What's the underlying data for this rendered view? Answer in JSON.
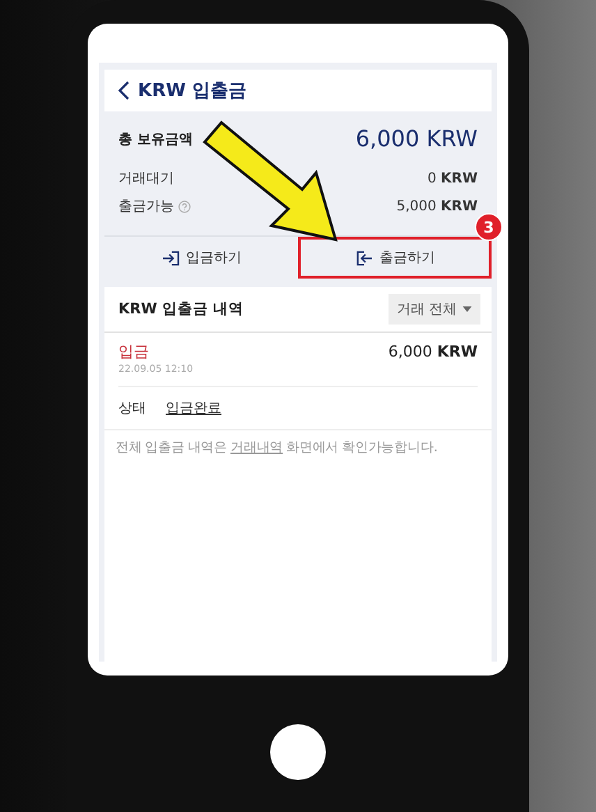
{
  "header": {
    "title": "KRW 입출금"
  },
  "summary": {
    "total_label": "총 보유금액",
    "total_value": "6,000 KRW",
    "rows": [
      {
        "label": "거래대기",
        "amount": "0 **KRW**",
        "help": false
      },
      {
        "label": "출금가능",
        "amount": "5,000 **KRW**",
        "help": true
      }
    ]
  },
  "actions": [
    {
      "kind": "deposit",
      "label": "입금하기",
      "highlighted": false
    },
    {
      "kind": "withdraw",
      "label": "출금하기",
      "highlighted": true
    }
  ],
  "history": {
    "title": "KRW 입출금 내역",
    "filter": "거래 전체",
    "entries": [
      {
        "type": "입금",
        "date": "22.09.05 12:10",
        "amount": "6,000 **KRW**",
        "status_label": "상태",
        "status": "입금완료"
      }
    ],
    "note": {
      "before": "전체 입출금 내역은",
      "link": "거래내역",
      "after": "화면에서 확인가능합니다."
    }
  },
  "annotation": {
    "step": "3"
  }
}
